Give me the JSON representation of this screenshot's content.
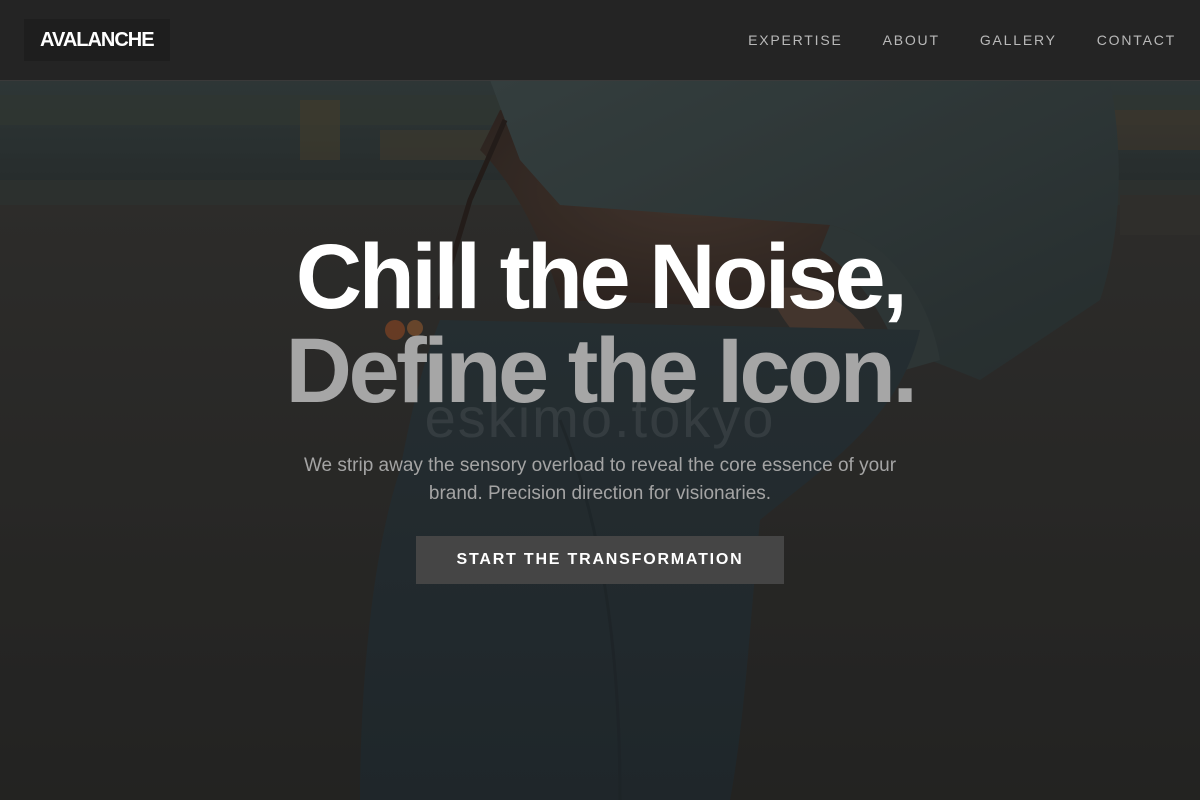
{
  "brand": {
    "logo_text": "AVALANCHE"
  },
  "nav": {
    "items": [
      {
        "label": "EXPERTISE"
      },
      {
        "label": "ABOUT"
      },
      {
        "label": "GALLERY"
      },
      {
        "label": "CONTACT"
      }
    ]
  },
  "hero": {
    "headline_line1": "Chill the Noise,",
    "headline_line2": "Define the Icon.",
    "subtext": "We strip away the sensory overload to reveal the core essence of your brand. Precision direction for visionaries.",
    "cta_label": "START THE TRANSFORMATION",
    "watermark": "eskimo.tokyo"
  },
  "colors": {
    "nav_background": "#242424",
    "headline_primary": "#ffffff",
    "headline_secondary": "#a6a6a6",
    "cta_background": "#454545"
  }
}
